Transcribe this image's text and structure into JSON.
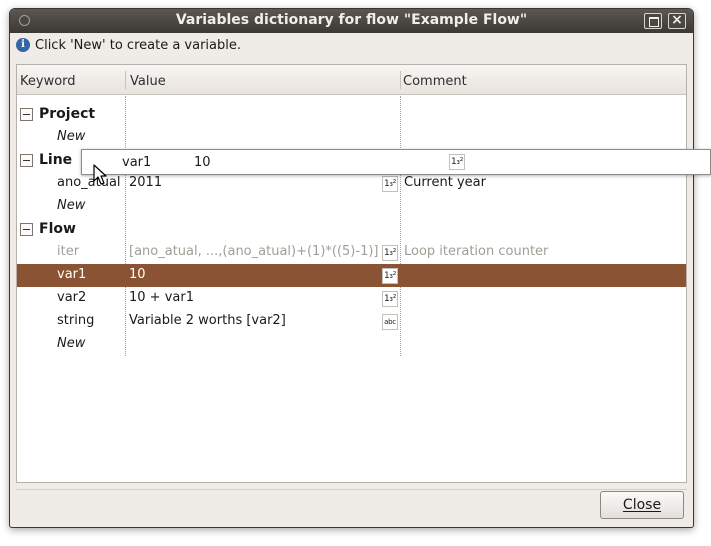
{
  "window": {
    "title": "Variables dictionary for flow \"Example Flow\""
  },
  "info": {
    "text": "Click 'New' to create a variable."
  },
  "table": {
    "columns": {
      "keyword": "Keyword",
      "value": "Value",
      "comment": "Comment"
    },
    "groups": {
      "project": {
        "name": "Project",
        "new_label": "New"
      },
      "line": {
        "name": "Line",
        "row": {
          "keyword": "ano_atual",
          "value": "2011",
          "comment": "Current year"
        },
        "new_label": "New"
      },
      "flow": {
        "name": "Flow",
        "rows": [
          {
            "keyword": "iter",
            "value": "[ano_atual, ...,(ano_atual)+(1)*((5)-1)]",
            "comment": "Loop iteration counter",
            "type": "number"
          },
          {
            "keyword": "var1",
            "value": "10",
            "comment": "",
            "type": "number"
          },
          {
            "keyword": "var2",
            "value": "10 + var1",
            "comment": "",
            "type": "number"
          },
          {
            "keyword": "string",
            "value": "Variable 2 worths [var2]",
            "comment": "",
            "type": "text"
          }
        ],
        "new_label": "New"
      }
    }
  },
  "drag_preview": {
    "keyword": "var1",
    "value": "10"
  },
  "icons": {
    "number_type": "1₃²",
    "text_type": "abc"
  },
  "colors": {
    "selection": "#8a5334",
    "titlebar": "#3c3935"
  },
  "footer": {
    "close_label": "Close"
  }
}
